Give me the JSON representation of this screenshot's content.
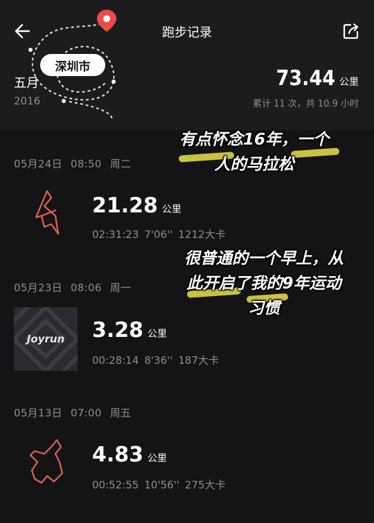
{
  "header": {
    "title": "跑步记录",
    "city": "深圳市",
    "month": "五月",
    "year": "2016",
    "total_distance": "73.44",
    "distance_unit": "公里",
    "summary": "累计 11 次，共 10.9 小时"
  },
  "runs": [
    {
      "date": "05月24日",
      "time": "08:50",
      "weekday": "周二",
      "distance": "21.28",
      "unit": "公里",
      "duration": "02:31:23",
      "pace": "7'06''",
      "calories": "1212大卡",
      "thumb": "route-map-icon"
    },
    {
      "date": "05月23日",
      "time": "08:06",
      "weekday": "周一",
      "distance": "3.28",
      "unit": "公里",
      "duration": "00:28:14",
      "pace": "8'36''",
      "calories": "187大卡",
      "thumb": "joyrun-logo",
      "thumb_text": "Joyrun"
    },
    {
      "date": "05月13日",
      "time": "07:00",
      "weekday": "周五",
      "distance": "4.83",
      "unit": "公里",
      "duration": "00:52:55",
      "pace": "10'56''",
      "calories": "275大卡",
      "thumb": "route-map-icon"
    }
  ],
  "overlay": {
    "line1a": "有点怀念16年，一个",
    "line1b": "人的马拉松",
    "line2a": "很普通的一个早上，从",
    "line2b": "此开启了我的9年运动",
    "line2c": "习惯"
  },
  "colors": {
    "accent_red": "#f04a4a",
    "route_stroke": "#e8614f",
    "highlight": "#ebe146"
  }
}
